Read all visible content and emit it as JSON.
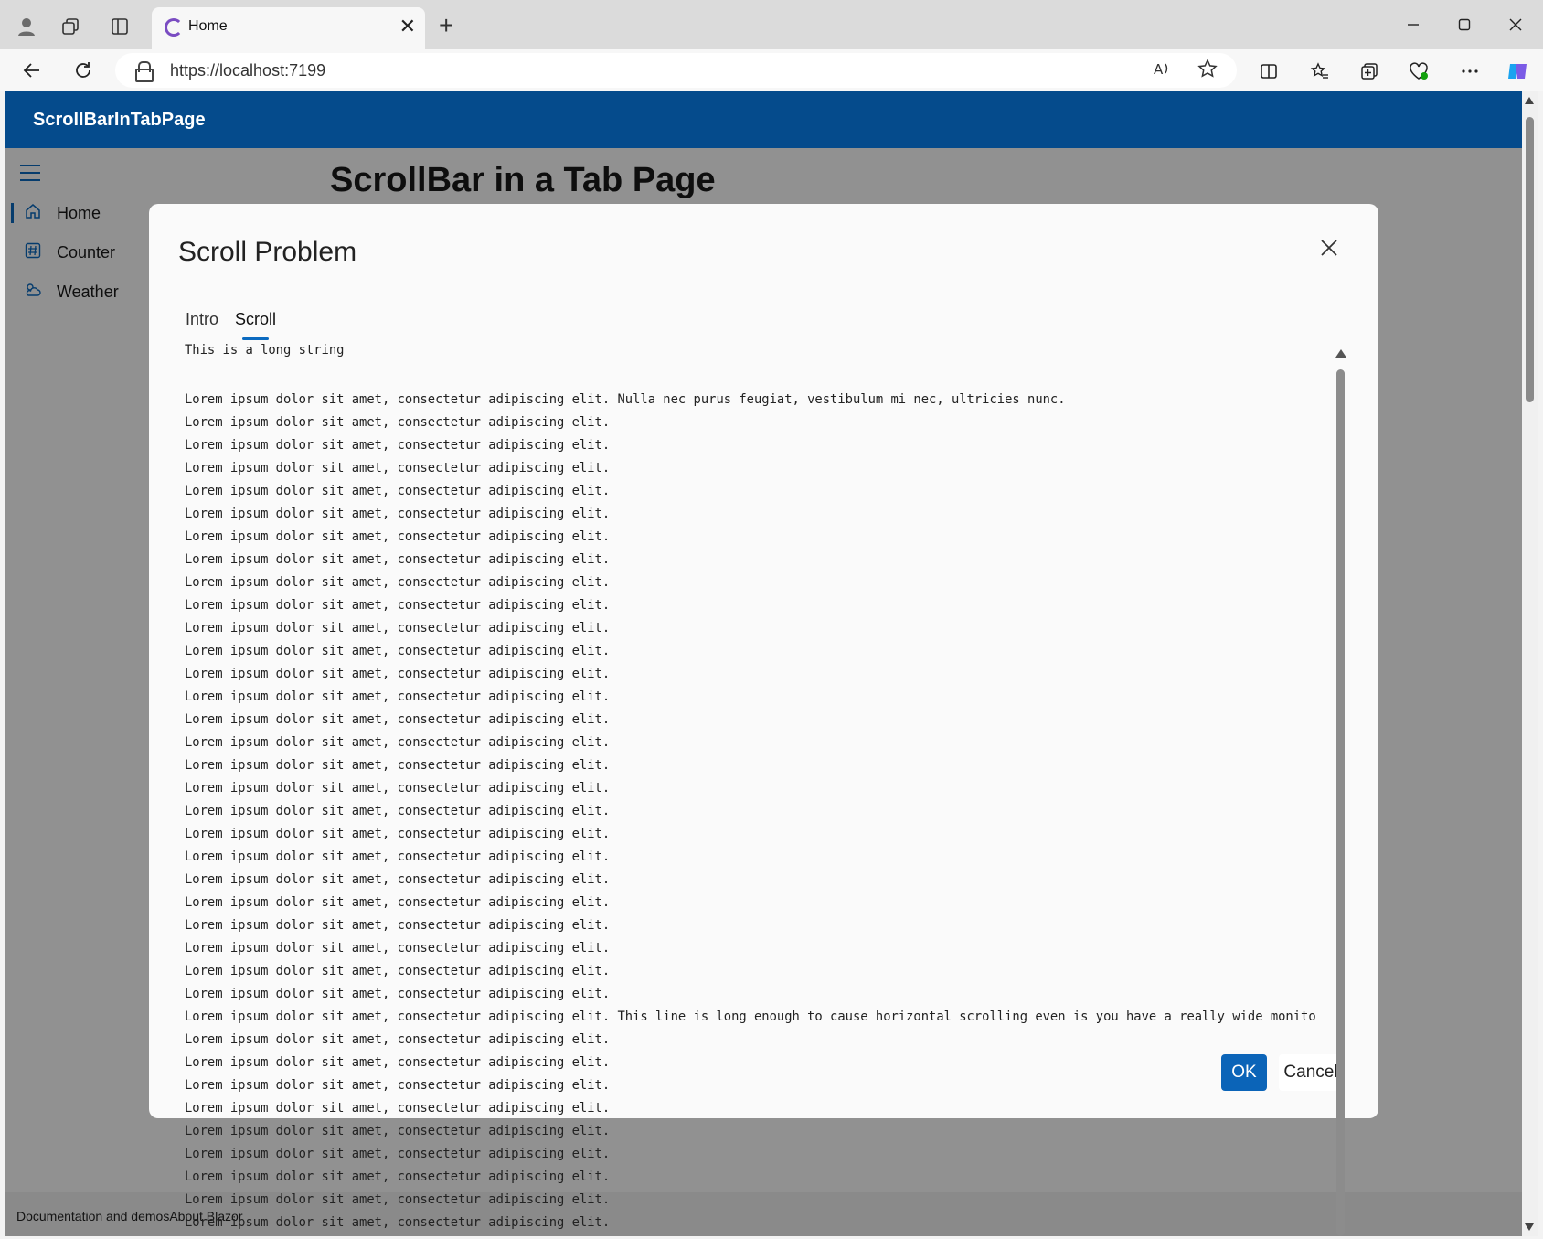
{
  "browser": {
    "tab_title": "Home",
    "tab_close": "✕",
    "new_tab": "+",
    "url": "https://localhost:7199",
    "window_controls": [
      "minimize",
      "maximize",
      "close"
    ]
  },
  "app": {
    "brand": "ScrollBarInTabPage",
    "page_title": "ScrollBar in a Tab Page",
    "nav": [
      {
        "label": "Home",
        "icon": "home-icon",
        "active": true
      },
      {
        "label": "Counter",
        "icon": "hash-icon",
        "active": false
      },
      {
        "label": "Weather",
        "icon": "weather-icon",
        "active": false
      }
    ],
    "footer_text": "Documentation and demosAbout Blazor"
  },
  "dialog": {
    "title": "Scroll Problem",
    "tabs": [
      {
        "label": "Intro",
        "selected": false
      },
      {
        "label": "Scroll",
        "selected": true
      }
    ],
    "ok_label": "OK",
    "cancel_label": "Cancel",
    "content": {
      "intro": "This is a long string",
      "lines": [
        "Lorem ipsum dolor sit amet, consectetur adipiscing elit. Nulla nec purus feugiat, vestibulum mi nec, ultricies nunc.",
        "Lorem ipsum dolor sit amet, consectetur adipiscing elit.",
        "Lorem ipsum dolor sit amet, consectetur adipiscing elit.",
        "Lorem ipsum dolor sit amet, consectetur adipiscing elit.",
        "Lorem ipsum dolor sit amet, consectetur adipiscing elit.",
        "Lorem ipsum dolor sit amet, consectetur adipiscing elit.",
        "Lorem ipsum dolor sit amet, consectetur adipiscing elit.",
        "Lorem ipsum dolor sit amet, consectetur adipiscing elit.",
        "Lorem ipsum dolor sit amet, consectetur adipiscing elit.",
        "Lorem ipsum dolor sit amet, consectetur adipiscing elit.",
        "Lorem ipsum dolor sit amet, consectetur adipiscing elit.",
        "Lorem ipsum dolor sit amet, consectetur adipiscing elit.",
        "Lorem ipsum dolor sit amet, consectetur adipiscing elit.",
        "Lorem ipsum dolor sit amet, consectetur adipiscing elit.",
        "Lorem ipsum dolor sit amet, consectetur adipiscing elit.",
        "Lorem ipsum dolor sit amet, consectetur adipiscing elit.",
        "Lorem ipsum dolor sit amet, consectetur adipiscing elit.",
        "Lorem ipsum dolor sit amet, consectetur adipiscing elit.",
        "Lorem ipsum dolor sit amet, consectetur adipiscing elit.",
        "Lorem ipsum dolor sit amet, consectetur adipiscing elit.",
        "Lorem ipsum dolor sit amet, consectetur adipiscing elit.",
        "Lorem ipsum dolor sit amet, consectetur adipiscing elit.",
        "Lorem ipsum dolor sit amet, consectetur adipiscing elit.",
        "Lorem ipsum dolor sit amet, consectetur adipiscing elit.",
        "Lorem ipsum dolor sit amet, consectetur adipiscing elit.",
        "Lorem ipsum dolor sit amet, consectetur adipiscing elit.",
        "Lorem ipsum dolor sit amet, consectetur adipiscing elit.",
        "Lorem ipsum dolor sit amet, consectetur adipiscing elit. This line is long enough to cause horizontal scrolling even is you have a really wide monito",
        "Lorem ipsum dolor sit amet, consectetur adipiscing elit.",
        "Lorem ipsum dolor sit amet, consectetur adipiscing elit.",
        "Lorem ipsum dolor sit amet, consectetur adipiscing elit.",
        "Lorem ipsum dolor sit amet, consectetur adipiscing elit.",
        "Lorem ipsum dolor sit amet, consectetur adipiscing elit.",
        "Lorem ipsum dolor sit amet, consectetur adipiscing elit.",
        "Lorem ipsum dolor sit amet, consectetur adipiscing elit.",
        "Lorem ipsum dolor sit amet, consectetur adipiscing elit.",
        "Lorem ipsum dolor sit amet, consectetur adipiscing elit."
      ]
    }
  },
  "colors": {
    "accent": "#0b64b8",
    "appbar": "#054b8c"
  }
}
